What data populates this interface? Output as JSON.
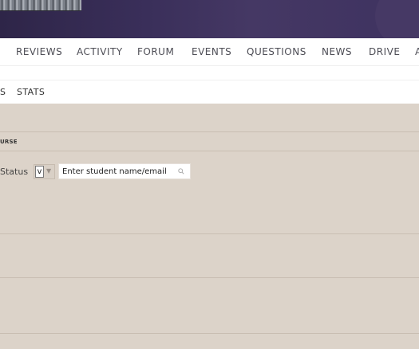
{
  "main_nav": {
    "items": [
      {
        "label": "REVIEWS"
      },
      {
        "label": "ACTIVITY"
      },
      {
        "label": "FORUM"
      },
      {
        "label": "EVENTS"
      },
      {
        "label": "QUESTIONS"
      },
      {
        "label": "NEWS"
      },
      {
        "label": "DRIVE"
      },
      {
        "label": "A"
      }
    ]
  },
  "sub_nav": {
    "items": [
      {
        "label": "S"
      },
      {
        "label": "STATS"
      }
    ]
  },
  "content": {
    "section_label": "URSE",
    "status_label": "Status",
    "status_select_value": "v",
    "search": {
      "placeholder": "Enter student name/email"
    }
  },
  "colors": {
    "banner": "#3a2f5a",
    "content_bg": "#dcd3c9",
    "nav_text": "#4d4d55"
  },
  "icons": [
    "chevron-down-icon",
    "search-icon"
  ]
}
